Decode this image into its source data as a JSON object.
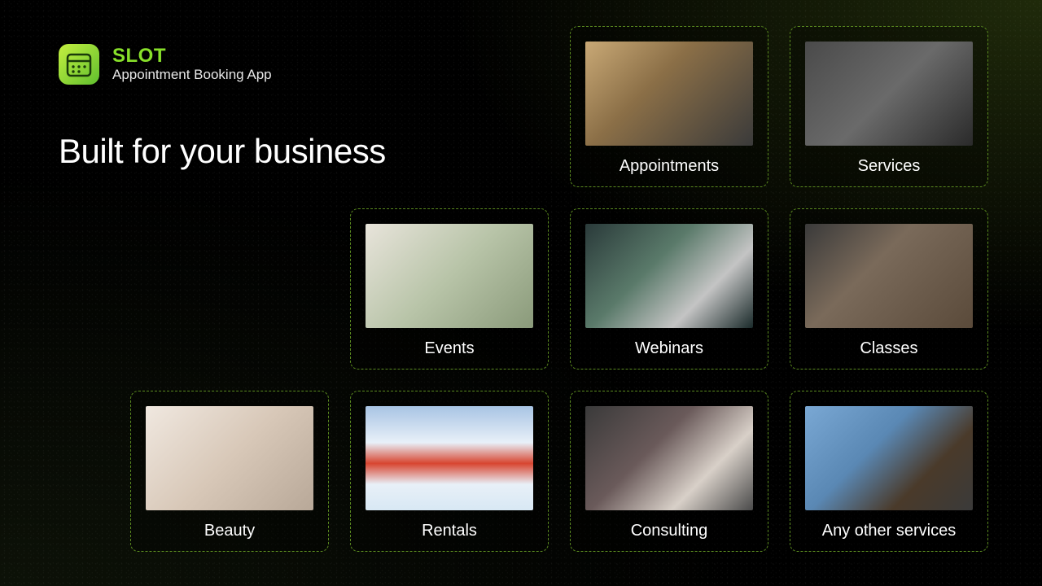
{
  "brand": {
    "name": "SLOT",
    "tagline": "Appointment Booking App"
  },
  "headline": "Built for your business",
  "cards": [
    {
      "label": "Appointments",
      "image_semantic": "team-meeting-table"
    },
    {
      "label": "Services",
      "image_semantic": "car-engine-repair"
    },
    {
      "label": "Events",
      "image_semantic": "wedding-reception-tables"
    },
    {
      "label": "Webinars",
      "image_semantic": "laptop-video-call-mug"
    },
    {
      "label": "Classes",
      "image_semantic": "yoga-fitness-class"
    },
    {
      "label": "Beauty",
      "image_semantic": "manicure-nails"
    },
    {
      "label": "Rentals",
      "image_semantic": "skis-snow-mountain"
    },
    {
      "label": "Consulting",
      "image_semantic": "business-meeting-laptop"
    },
    {
      "label": "Any other services",
      "image_semantic": "handshake-office"
    }
  ],
  "colors": {
    "accent": "#88e02a",
    "border": "#5a8a1f",
    "background": "#000000"
  }
}
